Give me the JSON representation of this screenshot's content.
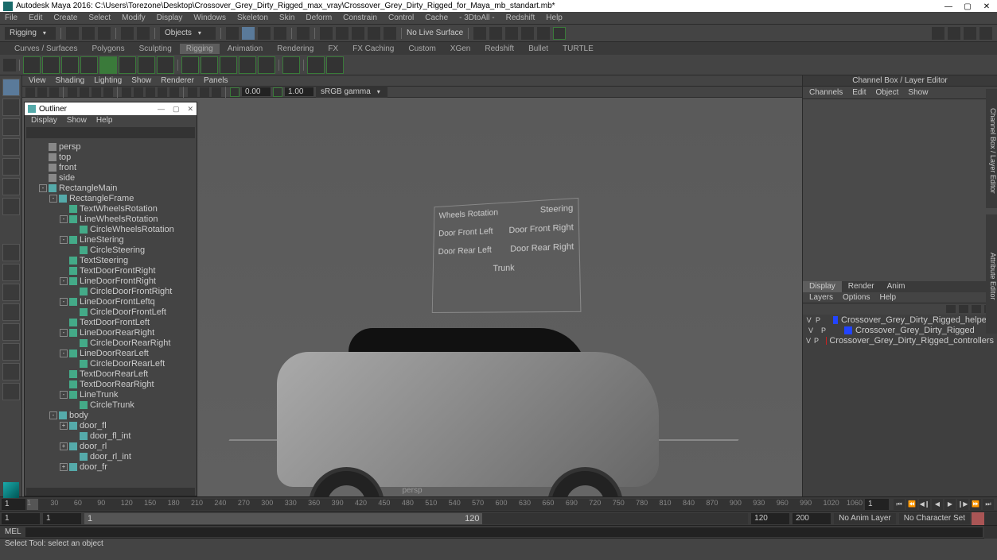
{
  "title": "Autodesk Maya 2016: C:\\Users\\Torezone\\Desktop\\Crossover_Grey_Dirty_Rigged_max_vray\\Crossover_Grey_Dirty_Rigged_for_Maya_mb_standart.mb*",
  "menus": [
    "File",
    "Edit",
    "Create",
    "Select",
    "Modify",
    "Display",
    "Windows",
    "Skeleton",
    "Skin",
    "Deform",
    "Constrain",
    "Control",
    "Cache",
    "- 3DtoAll -",
    "Redshift",
    "Help"
  ],
  "workspace_dd": "Rigging",
  "mask_dd": "Objects",
  "live_surface": "No Live Surface",
  "shelf_tabs": [
    "Curves / Surfaces",
    "Polygons",
    "Sculpting",
    "Rigging",
    "Animation",
    "Rendering",
    "FX",
    "FX Caching",
    "Custom",
    "XGen",
    "Redshift",
    "Bullet",
    "TURTLE"
  ],
  "shelf_active": 3,
  "vp_menus": [
    "View",
    "Shading",
    "Lighting",
    "Show",
    "Renderer",
    "Panels"
  ],
  "vp_time1": "0.00",
  "vp_time2": "1.00",
  "vp_gamma": "sRGB gamma",
  "vp_persp": "persp",
  "rig_controls": {
    "r1a": "Wheels Rotation",
    "r1b": "Steering",
    "r2a": "Door Front Left",
    "r2b": "Door Front Right",
    "r3a": "Door Rear Left",
    "r3b": "Door Rear Right",
    "r4": "Trunk"
  },
  "outliner": {
    "title": "Outliner",
    "menus": [
      "Display",
      "Show",
      "Help"
    ],
    "cameras": [
      "persp",
      "top",
      "front",
      "side"
    ],
    "nodes": [
      {
        "d": 0,
        "e": "-",
        "n": "RectangleMain"
      },
      {
        "d": 1,
        "e": "-",
        "n": "RectangleFrame"
      },
      {
        "d": 2,
        "e": "",
        "n": "TextWheelsRotation",
        "t": "curve"
      },
      {
        "d": 2,
        "e": "-",
        "n": "LineWheelsRotation",
        "t": "curve"
      },
      {
        "d": 3,
        "e": "",
        "n": "CircleWheelsRotation",
        "t": "curve"
      },
      {
        "d": 2,
        "e": "-",
        "n": "LineStering",
        "t": "curve"
      },
      {
        "d": 3,
        "e": "",
        "n": "CircleSteering",
        "t": "curve"
      },
      {
        "d": 2,
        "e": "",
        "n": "TextSteering",
        "t": "curve"
      },
      {
        "d": 2,
        "e": "",
        "n": "TextDoorFrontRight",
        "t": "curve"
      },
      {
        "d": 2,
        "e": "-",
        "n": "LineDoorFrontRight",
        "t": "curve"
      },
      {
        "d": 3,
        "e": "",
        "n": "CircleDoorFrontRight",
        "t": "curve"
      },
      {
        "d": 2,
        "e": "-",
        "n": "LineDoorFrontLeftq",
        "t": "curve"
      },
      {
        "d": 3,
        "e": "",
        "n": "CircleDoorFrontLeft",
        "t": "curve"
      },
      {
        "d": 2,
        "e": "",
        "n": "TextDoorFrontLeft",
        "t": "curve"
      },
      {
        "d": 2,
        "e": "-",
        "n": "LineDoorRearRight",
        "t": "curve"
      },
      {
        "d": 3,
        "e": "",
        "n": "CircleDoorRearRight",
        "t": "curve"
      },
      {
        "d": 2,
        "e": "-",
        "n": "LineDoorRearLeft",
        "t": "curve"
      },
      {
        "d": 3,
        "e": "",
        "n": "CircleDoorRearLeft",
        "t": "curve"
      },
      {
        "d": 2,
        "e": "",
        "n": "TextDoorRearLeft",
        "t": "curve"
      },
      {
        "d": 2,
        "e": "",
        "n": "TextDoorRearRight",
        "t": "curve"
      },
      {
        "d": 2,
        "e": "-",
        "n": "LineTrunk",
        "t": "curve"
      },
      {
        "d": 3,
        "e": "",
        "n": "CircleTrunk",
        "t": "curve"
      },
      {
        "d": 1,
        "e": "-",
        "n": "body"
      },
      {
        "d": 2,
        "e": "+",
        "n": "door_fl"
      },
      {
        "d": 3,
        "e": "",
        "n": "door_fl_int"
      },
      {
        "d": 2,
        "e": "+",
        "n": "door_rl"
      },
      {
        "d": 3,
        "e": "",
        "n": "door_rl_int"
      },
      {
        "d": 2,
        "e": "+",
        "n": "door_fr"
      }
    ]
  },
  "right": {
    "title": "Channel Box / Layer Editor",
    "tabs": [
      "Channels",
      "Edit",
      "Object",
      "Show"
    ],
    "display_tabs": [
      "Display",
      "Render",
      "Anim"
    ],
    "layer_menu": [
      "Layers",
      "Options",
      "Help"
    ],
    "layers": [
      {
        "v": "V",
        "p": "P",
        "c": "#2244ff",
        "n": "Crossover_Grey_Dirty_Rigged_helpers"
      },
      {
        "v": "V",
        "p": "P",
        "c": "#2244ff",
        "n": "Crossover_Grey_Dirty_Rigged"
      },
      {
        "v": "V",
        "p": "P",
        "c": "#cc2222",
        "n": "Crossover_Grey_Dirty_Rigged_controllers"
      }
    ]
  },
  "side_tab": "Channel Box / Layer Editor",
  "side_tab2": "Attribute Editor",
  "timeline": {
    "start_field": "1",
    "ticks": [
      1,
      30,
      60,
      90,
      120,
      150,
      180,
      210,
      240,
      270,
      300,
      330,
      360,
      390,
      420,
      450,
      480,
      510,
      540,
      570,
      600,
      630,
      660,
      690,
      720,
      750,
      780,
      810,
      840,
      870,
      900,
      930,
      960,
      990,
      1020,
      1060
    ],
    "end_field": "1"
  },
  "range": {
    "start_a": "1",
    "start_b": "1",
    "lo": "1",
    "hi": "120",
    "end_a": "120",
    "end_b": "200",
    "anim_layer": "No Anim Layer",
    "char_set": "No Character Set"
  },
  "cmd": "MEL",
  "status": "Select Tool: select an object"
}
